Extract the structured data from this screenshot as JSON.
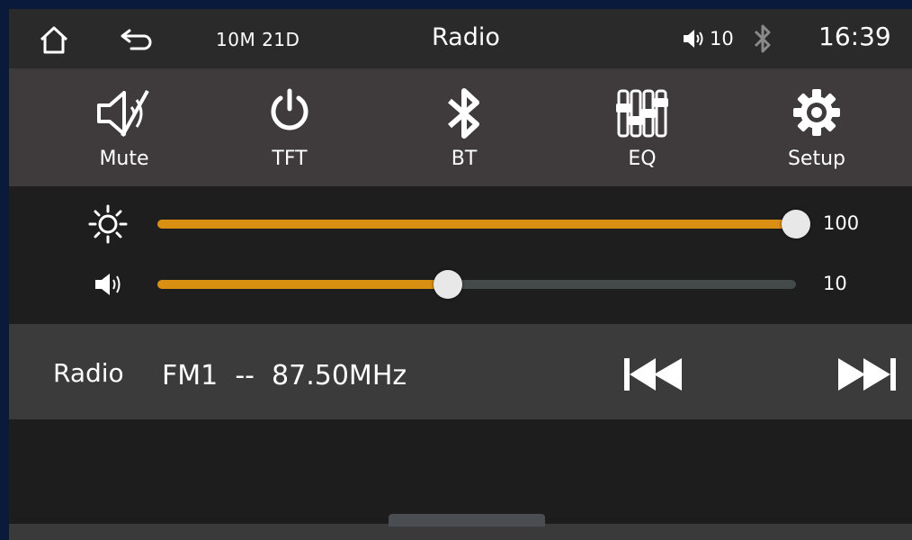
{
  "statusbar": {
    "home_icon": "home-icon",
    "back_icon": "back-arrow-icon",
    "date": "10M 21D",
    "title": "Radio",
    "volume_icon": "speaker-icon",
    "volume_level": "10",
    "bluetooth_icon": "bluetooth-icon",
    "time": "16:39"
  },
  "quick_buttons": [
    {
      "label": "Mute",
      "icon": "mute-icon"
    },
    {
      "label": "TFT",
      "icon": "power-icon"
    },
    {
      "label": "BT",
      "icon": "bluetooth-icon"
    },
    {
      "label": "EQ",
      "icon": "equalizer-icon"
    },
    {
      "label": "Setup",
      "icon": "gear-icon"
    }
  ],
  "sliders": {
    "brightness": {
      "icon": "brightness-icon",
      "value": "100",
      "fraction": 1.0
    },
    "volume": {
      "icon": "speaker-icon",
      "value": "10",
      "fraction": 0.455
    }
  },
  "radio": {
    "label": "Radio",
    "band": "FM1",
    "separator": "--",
    "frequency": "87.50MHz",
    "prev_icon": "skip-previous-icon",
    "next_icon": "skip-next-icon"
  },
  "colors": {
    "accent": "#d98f12",
    "track": "#444a4a",
    "background": "#1d1d1d",
    "button_bar": "#3f3b3c",
    "radio_bar": "#3b3b3b"
  }
}
